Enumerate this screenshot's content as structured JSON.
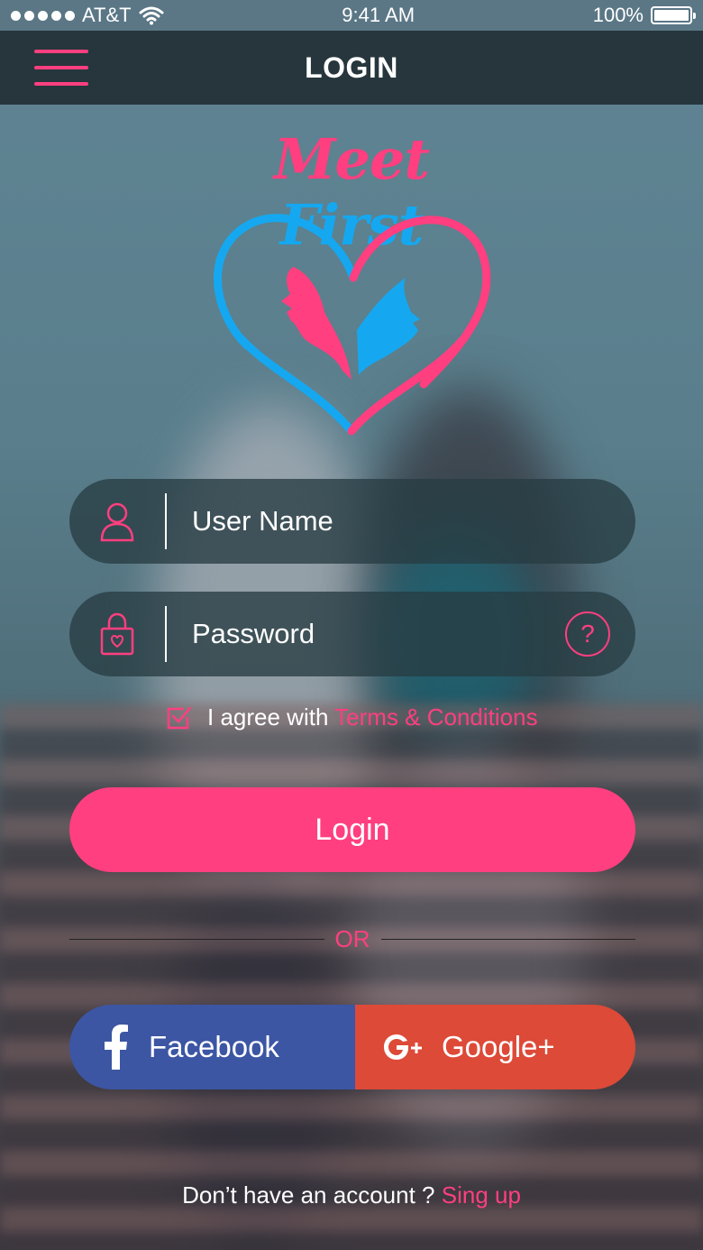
{
  "status_bar": {
    "carrier": "AT&T",
    "time": "9:41 AM",
    "battery": "100%"
  },
  "nav": {
    "title": "LOGIN"
  },
  "logo": {
    "word1": "Meet",
    "word2": "First"
  },
  "form": {
    "username_placeholder": "User Name",
    "password_placeholder": "Password",
    "help_label": "?",
    "agree_text": "I agree with",
    "terms_link": "Terms & Conditions",
    "agree_checked": true
  },
  "login_button": "Login",
  "divider_text": "OR",
  "social": {
    "facebook_label": "Facebook",
    "google_label": "Google+"
  },
  "signup": {
    "prompt": "Don’t have an account ?",
    "link": "Sing up"
  },
  "colors": {
    "accent_pink": "#ff3f7f",
    "accent_blue": "#15a8f0",
    "facebook": "#3c56a4",
    "google": "#dd4a38",
    "nav_bg": "#26363c"
  },
  "icons": [
    "menu-icon",
    "wifi-icon",
    "battery-icon",
    "user-icon",
    "lock-icon",
    "help-icon",
    "checkbox-icon",
    "facebook-icon",
    "google-plus-icon"
  ]
}
